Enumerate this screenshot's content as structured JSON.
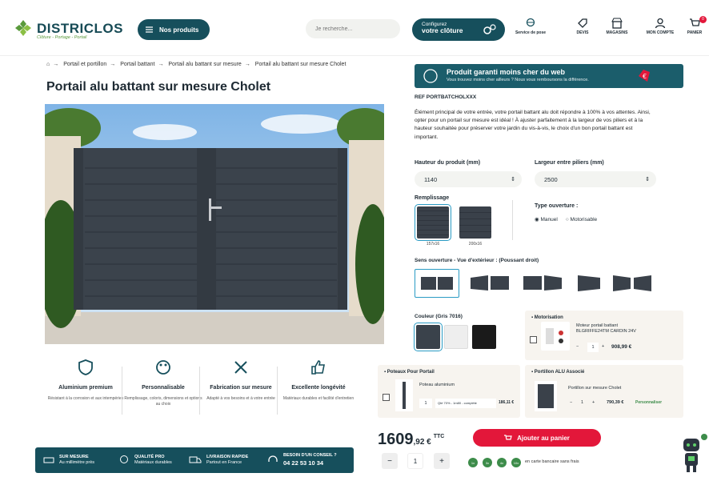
{
  "header": {
    "logo": "DISTRICLOS",
    "tagline": "Clôture - Portage - Portail",
    "products_button": "Nos produits",
    "search_placeholder": "Je recherche...",
    "config_line1": "Configurez",
    "config_line2": "votre clôture",
    "nav": [
      "Service de pose",
      "DEVIS",
      "MAGASINS",
      "MON COMPTE",
      "PANIER"
    ],
    "cart_count": "0"
  },
  "breadcrumb": [
    "Portail et portillon",
    "Portail battant",
    "Portail alu battant sur mesure",
    "Portail alu battant sur mesure Cholet"
  ],
  "product": {
    "title": "Portail alu battant sur mesure Cholet",
    "ref": "REF PORTBATCHOLXXX",
    "guarantee_title": "Produit garanti moins cher du web",
    "guarantee_sub": "Vous trouvez moins cher ailleurs ? Nous vous remboursons la différence.",
    "description": "Élément principal de votre entrée, votre portail battant alu doit répondre à 100% à vos attentes. Ainsi, opter pour un portail sur mesure est idéal ! À ajuster parfaitement à la largeur de vos piliers et à la hauteur souhaitée pour préserver votre jardin du vis-à-vis, le choix d'un bon portail battant est important.",
    "height_label": "Hauteur du produit (mm)",
    "height_value": "1140",
    "width_label": "Largeur entre piliers (mm)",
    "width_value": "2500",
    "fill_label": "Remplissage",
    "fill_options": [
      "157x16",
      "200x16"
    ],
    "opening_label": "Type ouverture :",
    "opening_options": [
      "Manuel",
      "Motorisable"
    ],
    "direction_label": "Sens ouverture - Vue d'extérieur : (Poussant droit)",
    "color_label": "Couleur (Gris 7016)",
    "colors": [
      "#3a424b",
      "#eeeeee",
      "#1a1a1a"
    ],
    "motor": {
      "header": "Motorisation",
      "name": "Moteur portail battant",
      "detail": "BLGRIFFE24TM CARDIN 24V",
      "qty": "1",
      "price": "908,99 €"
    },
    "post": {
      "header": "Poteaux Pour Portail",
      "name": "Poteau aluminium",
      "qty": "1",
      "select": "Qté 70% - 1m80 - complète",
      "price": "186,11 €"
    },
    "portillon": {
      "header": "Portillon ALU Associé",
      "name": "Portillon sur mesure Cholet",
      "qty": "1",
      "price": "790,39 €",
      "link": "Personnaliser"
    },
    "price_int": "1609",
    "price_dec": ",92 €",
    "price_ttc": "TTC",
    "cart_button": "Ajouter au panier",
    "qty": "1",
    "payment_text": "en carte bancaire sans frais",
    "payment_badges": [
      "1x",
      "3x",
      "4x",
      "10x"
    ]
  },
  "features": [
    {
      "title": "Aluminium premium",
      "desc": "Résistant à la corrosion et aux intempéries"
    },
    {
      "title": "Personnalisable",
      "desc": "Remplissage, coloris, dimensions et options au choix"
    },
    {
      "title": "Fabrication sur mesure",
      "desc": "Adapté à vos besoins et à votre entrée"
    },
    {
      "title": "Excellente longévité",
      "desc": "Matériaux durables et facilité d'entretien"
    }
  ],
  "banner": [
    {
      "title": "SUR MESURE",
      "sub": "Au millimètre près"
    },
    {
      "title": "QUALITÉ PRO",
      "sub": "Matériaux durables"
    },
    {
      "title": "LIVRAISON RAPIDE",
      "sub": "Partout en France"
    },
    {
      "title": "BESOIN D'UN CONSEIL ?",
      "sub": "04 22 53 10 34"
    }
  ]
}
